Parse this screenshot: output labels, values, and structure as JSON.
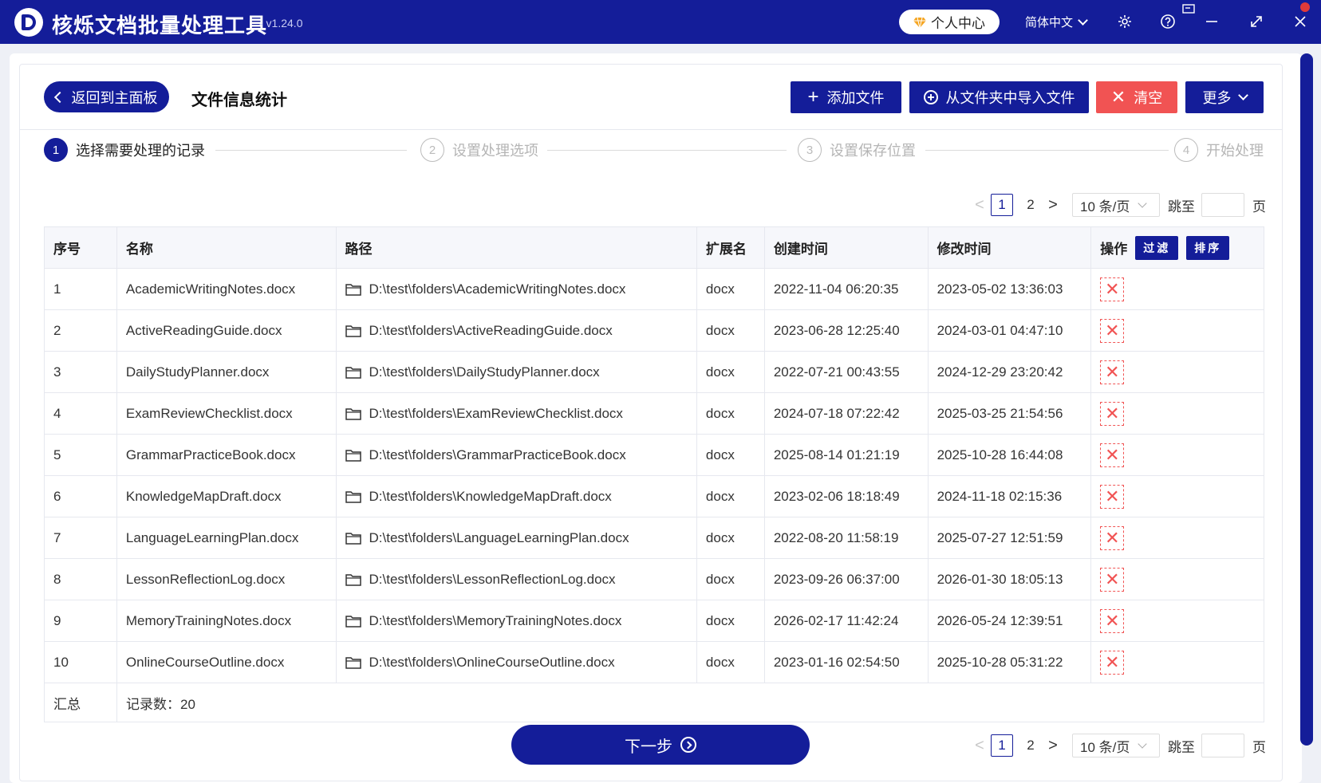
{
  "app": {
    "title": "核烁文档批量处理工具",
    "version": "- v1.24.0",
    "personal_center": "个人中心",
    "language": "简体中文"
  },
  "header": {
    "back_label": "返回到主面板",
    "page_title": "文件信息统计",
    "add_file": "添加文件",
    "import_folder": "从文件夹中导入文件",
    "clear": "清空",
    "more": "更多"
  },
  "steps": [
    {
      "num": "1",
      "label": "选择需要处理的记录"
    },
    {
      "num": "2",
      "label": "设置处理选项"
    },
    {
      "num": "3",
      "label": "设置保存位置"
    },
    {
      "num": "4",
      "label": "开始处理"
    }
  ],
  "pagination": {
    "prev": "<",
    "next": ">",
    "pages": [
      "1",
      "2"
    ],
    "page_size": "10 条/页",
    "jump_label": "跳至",
    "page_suffix": "页"
  },
  "table": {
    "headers": {
      "no": "序号",
      "name": "名称",
      "path": "路径",
      "ext": "扩展名",
      "ctime": "创建时间",
      "mtime": "修改时间",
      "op": "操作",
      "filter": "过滤",
      "sort": "排序"
    },
    "rows": [
      {
        "no": "1",
        "name": "AcademicWritingNotes.docx",
        "path": "D:\\test\\folders\\AcademicWritingNotes.docx",
        "ext": "docx",
        "ctime": "2022-11-04 06:20:35",
        "mtime": "2023-05-02 13:36:03"
      },
      {
        "no": "2",
        "name": "ActiveReadingGuide.docx",
        "path": "D:\\test\\folders\\ActiveReadingGuide.docx",
        "ext": "docx",
        "ctime": "2023-06-28 12:25:40",
        "mtime": "2024-03-01 04:47:10"
      },
      {
        "no": "3",
        "name": "DailyStudyPlanner.docx",
        "path": "D:\\test\\folders\\DailyStudyPlanner.docx",
        "ext": "docx",
        "ctime": "2022-07-21 00:43:55",
        "mtime": "2024-12-29 23:20:42"
      },
      {
        "no": "4",
        "name": "ExamReviewChecklist.docx",
        "path": "D:\\test\\folders\\ExamReviewChecklist.docx",
        "ext": "docx",
        "ctime": "2024-07-18 07:22:42",
        "mtime": "2025-03-25 21:54:56"
      },
      {
        "no": "5",
        "name": "GrammarPracticeBook.docx",
        "path": "D:\\test\\folders\\GrammarPracticeBook.docx",
        "ext": "docx",
        "ctime": "2025-08-14 01:21:19",
        "mtime": "2025-10-28 16:44:08"
      },
      {
        "no": "6",
        "name": "KnowledgeMapDraft.docx",
        "path": "D:\\test\\folders\\KnowledgeMapDraft.docx",
        "ext": "docx",
        "ctime": "2023-02-06 18:18:49",
        "mtime": "2024-11-18 02:15:36"
      },
      {
        "no": "7",
        "name": "LanguageLearningPlan.docx",
        "path": "D:\\test\\folders\\LanguageLearningPlan.docx",
        "ext": "docx",
        "ctime": "2022-08-20 11:58:19",
        "mtime": "2025-07-27 12:51:59"
      },
      {
        "no": "8",
        "name": "LessonReflectionLog.docx",
        "path": "D:\\test\\folders\\LessonReflectionLog.docx",
        "ext": "docx",
        "ctime": "2023-09-26 06:37:00",
        "mtime": "2026-01-30 18:05:13"
      },
      {
        "no": "9",
        "name": "MemoryTrainingNotes.docx",
        "path": "D:\\test\\folders\\MemoryTrainingNotes.docx",
        "ext": "docx",
        "ctime": "2026-02-17 11:42:24",
        "mtime": "2026-05-24 12:39:51"
      },
      {
        "no": "10",
        "name": "OnlineCourseOutline.docx",
        "path": "D:\\test\\folders\\OnlineCourseOutline.docx",
        "ext": "docx",
        "ctime": "2023-01-16 02:54:50",
        "mtime": "2025-10-28 05:31:22"
      }
    ],
    "summary_label": "汇总",
    "record_count": "记录数：20"
  },
  "next_label": "下一步",
  "colors": {
    "primary": "#141d99",
    "danger": "#f15353"
  }
}
